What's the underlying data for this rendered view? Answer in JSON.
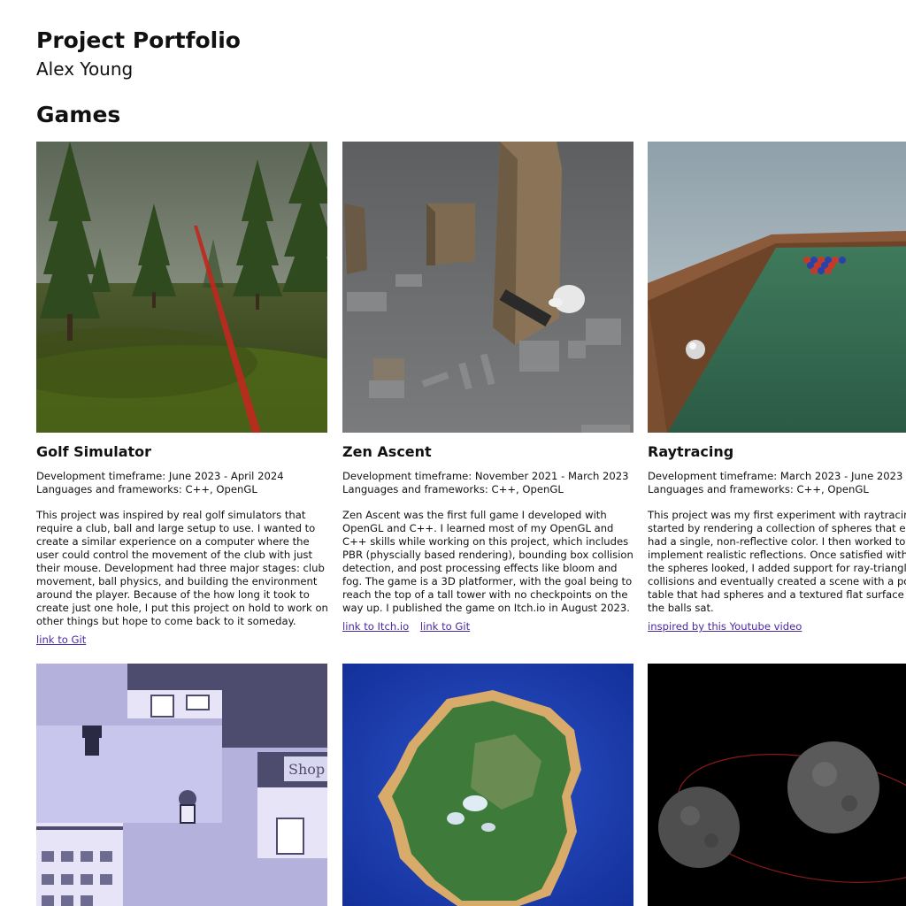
{
  "header": {
    "title": "Project Portfolio",
    "author": "Alex Young"
  },
  "section": {
    "title": "Games"
  },
  "projects": [
    {
      "title": "Golf Simulator",
      "timeframe": "Development timeframe: June 2023 - April 2024",
      "languages": "Languages and frameworks: C++, OpenGL",
      "description": "This project was inspired by real golf simulators that require a club, ball and large setup to use. I wanted to create a similar experience on a computer where the user could control the movement of the club with just their mouse. Development had three major stages: club movement, ball physics, and building the environment around the player. Because of the how long it took to create just one hole, I put this project on hold to work on other things but hope to come back to it someday.",
      "links": [
        "link to Git"
      ],
      "image": "golf-course-screenshot"
    },
    {
      "title": "Zen Ascent",
      "timeframe": "Development timeframe: November 2021 - March 2023",
      "languages": "Languages and frameworks: C++, OpenGL",
      "description": "Zen Ascent was the first full game I developed with OpenGL and C++. I learned most of my OpenGL and C++ skills while working on this project, which includes PBR (physcially based rendering), bounding box collision detection, and post processing effects like bloom and fog. The game is a 3D platformer, with the goal being to reach the top of a tall tower with no checkpoints on the way up. I published the game on Itch.io in August 2023.",
      "links": [
        "link to Itch.io",
        "link to Git"
      ],
      "image": "platformer-tower-screenshot"
    },
    {
      "title": "Raytracing",
      "timeframe": "Development timeframe: March 2023 - June 2023",
      "languages": "Languages and frameworks: C++, OpenGL",
      "description": "This project was my first experiment with raytracing. I started by rendering a collection of spheres that each had a single, non-reflective color. I then worked to implement realistic reflections. Once satisfied with how the spheres looked, I added support for ray-triangle collisions and eventually created a scene with a pool table that had spheres and a textured flat surface where the balls sat.",
      "links": [
        "inspired by this Youtube video"
      ],
      "image": "pool-table-screenshot"
    }
  ],
  "second_row_images": [
    "pixel-town-screenshot",
    "terrain-island-screenshot",
    "asteroids-orbit-screenshot"
  ],
  "colors": {
    "text": "#111111",
    "link": "#4a2aa0",
    "background": "#ffffff"
  }
}
